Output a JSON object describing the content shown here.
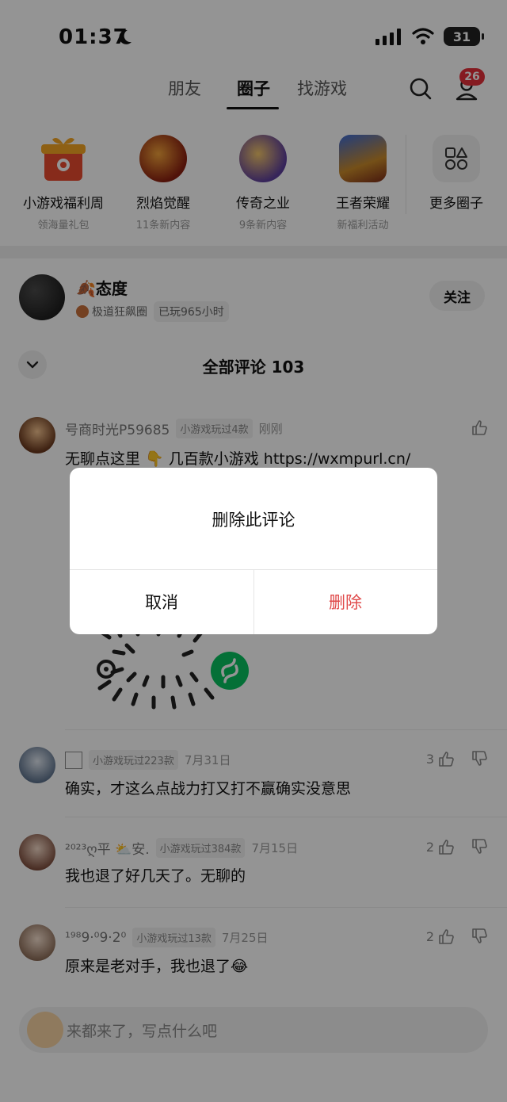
{
  "status_bar": {
    "time": "01:37",
    "battery": "31"
  },
  "nav": {
    "tabs": [
      {
        "label": "朋友",
        "active": false
      },
      {
        "label": "圈子",
        "active": true
      },
      {
        "label": "找游戏",
        "active": false
      }
    ],
    "badge_count": "26",
    "icons": [
      "search-icon",
      "user-icon"
    ]
  },
  "circles": [
    {
      "title": "小游戏福利周",
      "sub": "领海量礼包",
      "icon": "gift-icon",
      "color": "#e84a2f"
    },
    {
      "title": "烈焰觉醒",
      "sub": "11条新内容",
      "icon": "game-lieyan",
      "color": "#b6381e"
    },
    {
      "title": "传奇之业",
      "sub": "9条新内容",
      "icon": "game-chuanqi",
      "color": "#5d3f9c"
    },
    {
      "title": "王者荣耀",
      "sub": "新福利活动",
      "icon": "game-wangzhe",
      "color": "#c98a2a"
    },
    {
      "title": "更多圈子",
      "sub": "",
      "icon": "more-circles-icon",
      "color": "#f1f1f1"
    }
  ],
  "author": {
    "name": "态度",
    "circle": "极道狂飙圈",
    "play_time": "已玩965小时",
    "follow_label": "关注"
  },
  "comments_header": {
    "title": "全部评论 103"
  },
  "comments": [
    {
      "user": "号商时光P59685",
      "tag": "小游戏玩过4款",
      "time": "刚刚",
      "text": "无聊点这里 👇 几百款小游戏 https://wxmpurl.cn/",
      "likes": ""
    },
    {
      "user": "",
      "tag": "小游戏玩过223款",
      "time": "7月31日",
      "text": "确实，才这么点战力打又打不赢确实没意思",
      "likes": "3"
    },
    {
      "user": "²⁰²³ღ平 ⛅安.",
      "tag": "小游戏玩过384款",
      "time": "7月15日",
      "text": "我也退了好几天了。无聊的",
      "likes": "2"
    },
    {
      "user": "¹⁹⁸9·⁰9·2⁰",
      "tag": "小游戏玩过13款",
      "time": "7月25日",
      "text": "原来是老对手，我也退了😂",
      "likes": "2"
    }
  ],
  "input": {
    "placeholder": "来都来了，写点什么吧"
  },
  "dialog": {
    "title": "删除此评论",
    "cancel_label": "取消",
    "delete_label": "删除",
    "delete_color": "#e04a4a"
  }
}
